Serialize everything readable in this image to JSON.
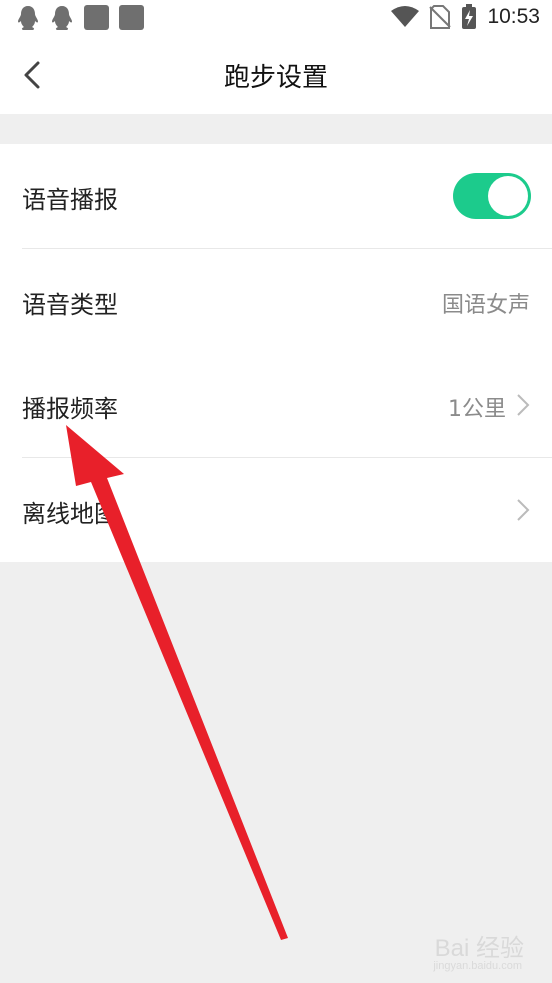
{
  "status_bar": {
    "time": "10:53"
  },
  "header": {
    "title": "跑步设置"
  },
  "settings": {
    "voice_broadcast": {
      "label": "语音播报",
      "enabled": true
    },
    "voice_type": {
      "label": "语音类型",
      "value": "国语女声"
    },
    "broadcast_frequency": {
      "label": "播报频率",
      "value": "1公里"
    },
    "offline_map": {
      "label": "离线地图"
    }
  },
  "colors": {
    "toggle_on": "#1ccb8c",
    "annotation_arrow": "#e8202a"
  },
  "watermark": {
    "text": "Bai 经验",
    "sub": "jingyan.baidu.com"
  }
}
